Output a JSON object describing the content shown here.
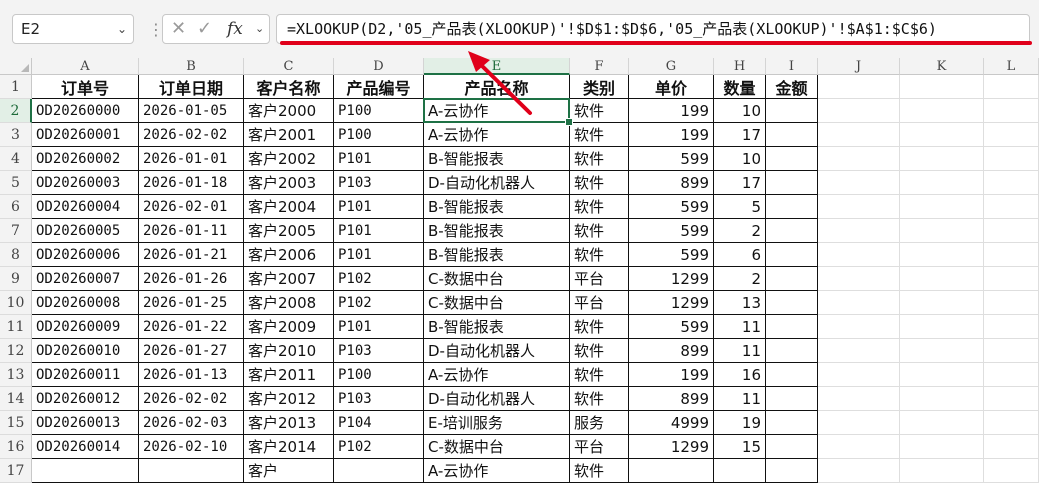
{
  "name_box": "E2",
  "formula": "=XLOOKUP(D2,'05_产品表(XLOOKUP)'!$D$1:$D$6,'05_产品表(XLOOKUP)'!$A$1:$C$6)",
  "icons": {
    "cancel": "close-icon",
    "confirm": "check-icon",
    "function": "fx-icon"
  },
  "fx_label": "fx",
  "columns": [
    "A",
    "B",
    "C",
    "D",
    "E",
    "F",
    "G",
    "H",
    "I",
    "J",
    "K",
    "L"
  ],
  "selected_column": "E",
  "selected_row": 2,
  "headers": [
    "订单号",
    "订单日期",
    "客户名称",
    "产品编号",
    "产品名称",
    "类别",
    "单价",
    "数量",
    "金额"
  ],
  "rows": [
    [
      "OD20260000",
      "2026-01-05",
      "客户2000",
      "P100",
      "A-云协作",
      "软件",
      "199",
      "10",
      ""
    ],
    [
      "OD20260001",
      "2026-02-02",
      "客户2001",
      "P100",
      "A-云协作",
      "软件",
      "199",
      "17",
      ""
    ],
    [
      "OD20260002",
      "2026-01-01",
      "客户2002",
      "P101",
      "B-智能报表",
      "软件",
      "599",
      "10",
      ""
    ],
    [
      "OD20260003",
      "2026-01-18",
      "客户2003",
      "P103",
      "D-自动化机器人",
      "软件",
      "899",
      "17",
      ""
    ],
    [
      "OD20260004",
      "2026-02-01",
      "客户2004",
      "P101",
      "B-智能报表",
      "软件",
      "599",
      "5",
      ""
    ],
    [
      "OD20260005",
      "2026-01-11",
      "客户2005",
      "P101",
      "B-智能报表",
      "软件",
      "599",
      "2",
      ""
    ],
    [
      "OD20260006",
      "2026-01-21",
      "客户2006",
      "P101",
      "B-智能报表",
      "软件",
      "599",
      "6",
      ""
    ],
    [
      "OD20260007",
      "2026-01-26",
      "客户2007",
      "P102",
      "C-数据中台",
      "平台",
      "1299",
      "2",
      ""
    ],
    [
      "OD20260008",
      "2026-01-25",
      "客户2008",
      "P102",
      "C-数据中台",
      "平台",
      "1299",
      "13",
      ""
    ],
    [
      "OD20260009",
      "2026-01-22",
      "客户2009",
      "P101",
      "B-智能报表",
      "软件",
      "599",
      "11",
      ""
    ],
    [
      "OD20260010",
      "2026-01-27",
      "客户2010",
      "P103",
      "D-自动化机器人",
      "软件",
      "899",
      "11",
      ""
    ],
    [
      "OD20260011",
      "2026-01-13",
      "客户2011",
      "P100",
      "A-云协作",
      "软件",
      "199",
      "16",
      ""
    ],
    [
      "OD20260012",
      "2026-02-02",
      "客户2012",
      "P103",
      "D-自动化机器人",
      "软件",
      "899",
      "11",
      ""
    ],
    [
      "OD20260013",
      "2026-02-03",
      "客户2013",
      "P104",
      "E-培训服务",
      "服务",
      "4999",
      "19",
      ""
    ],
    [
      "OD20260014",
      "2026-02-10",
      "客户2014",
      "P102",
      "C-数据中台",
      "平台",
      "1299",
      "15",
      ""
    ]
  ],
  "partial_row": [
    "",
    "",
    "客户",
    "",
    "A-云协作",
    "软件",
    "",
    "",
    ""
  ],
  "colors": {
    "accent": "#1e7145",
    "annotation": "#e0001a"
  }
}
